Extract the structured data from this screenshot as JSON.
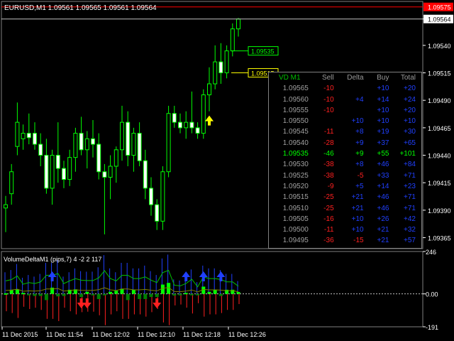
{
  "window": {
    "symbol_title": "EURUSD,M1  1.09561 1.09565 1.09561 1.09564",
    "indicator_title": "VolumeDeltaM1 (pips,7) 4 -2 2 117"
  },
  "price_axis": {
    "labels": [
      "1.09564",
      "1.09540",
      "1.09515",
      "1.09490",
      "1.09465",
      "1.09440",
      "1.09415",
      "1.09390",
      "1.09365"
    ],
    "ask_label": "1.09575",
    "current_label": "1.09564",
    "ask_color": "#ff0000"
  },
  "indicator_axis": {
    "labels": [
      "246",
      "0.00",
      "-191"
    ]
  },
  "time_axis": {
    "labels": [
      "11 Dec 2015",
      "11 Dec 11:54",
      "11 Dec 12:02",
      "11 Dec 12:10",
      "11 Dec 12:18",
      "11 Dec 12:26"
    ]
  },
  "price_levels": {
    "green_label": "1.09535",
    "yellow_label": "1.09515"
  },
  "vd_table": {
    "headers": {
      "title": "VD M1",
      "sell": "Sell",
      "delta": "Delta",
      "buy": "Buy",
      "total": "Total"
    },
    "rows": [
      {
        "price": "1.09565",
        "sell": "-10",
        "delta": "",
        "buy": "+10",
        "total": "+20"
      },
      {
        "price": "1.09560",
        "sell": "-10",
        "delta": "+4",
        "buy": "+14",
        "total": "+24"
      },
      {
        "price": "1.09555",
        "sell": "-10",
        "delta": "",
        "buy": "+10",
        "total": "+20"
      },
      {
        "price": "1.09550",
        "sell": "",
        "delta": "+10",
        "buy": "+10",
        "total": "+10"
      },
      {
        "price": "1.09545",
        "sell": "-11",
        "delta": "+8",
        "buy": "+19",
        "total": "+30"
      },
      {
        "price": "1.09540",
        "sell": "-28",
        "delta": "+9",
        "buy": "+37",
        "total": "+65"
      },
      {
        "price": "1.09535",
        "sell": "-46",
        "delta": "+9",
        "buy": "+55",
        "total": "+101",
        "highlight": true
      },
      {
        "price": "1.09530",
        "sell": "-38",
        "delta": "+8",
        "buy": "+46",
        "total": "+84"
      },
      {
        "price": "1.09525",
        "sell": "-38",
        "delta": "-5",
        "buy": "+33",
        "total": "+71"
      },
      {
        "price": "1.09520",
        "sell": "-9",
        "delta": "+5",
        "buy": "+14",
        "total": "+23"
      },
      {
        "price": "1.09515",
        "sell": "-25",
        "delta": "+21",
        "buy": "+46",
        "total": "+71"
      },
      {
        "price": "1.09510",
        "sell": "-25",
        "delta": "+21",
        "buy": "+46",
        "total": "+71"
      },
      {
        "price": "1.09505",
        "sell": "-16",
        "delta": "+10",
        "buy": "+26",
        "total": "+42"
      },
      {
        "price": "1.09500",
        "sell": "-11",
        "delta": "+10",
        "buy": "+21",
        "total": "+32"
      },
      {
        "price": "1.09495",
        "sell": "-36",
        "delta": "-15",
        "buy": "+21",
        "total": "+57"
      }
    ]
  },
  "colors": {
    "candle": "#00ff00",
    "grid": "#444444",
    "buy": "#2040ff",
    "sell": "#ff2020",
    "highlight": "#00ff00",
    "table_price": "#a0a0a0"
  },
  "chart_data": {
    "type": "candlestick",
    "price_range": [
      1.09355,
      1.0958
    ],
    "candles": [
      {
        "o": 1.09392,
        "h": 1.09403,
        "l": 1.0937,
        "c": 1.09395
      },
      {
        "o": 1.09405,
        "h": 1.09432,
        "l": 1.09395,
        "c": 1.09425
      },
      {
        "o": 1.09448,
        "h": 1.09488,
        "l": 1.0944,
        "c": 1.0947
      },
      {
        "o": 1.09455,
        "h": 1.09468,
        "l": 1.09445,
        "c": 1.0946
      },
      {
        "o": 1.0946,
        "h": 1.09478,
        "l": 1.0945,
        "c": 1.09456
      },
      {
        "o": 1.0946,
        "h": 1.0947,
        "l": 1.09445,
        "c": 1.0945
      },
      {
        "o": 1.0945,
        "h": 1.0946,
        "l": 1.0943,
        "c": 1.0944
      },
      {
        "o": 1.0944,
        "h": 1.09455,
        "l": 1.09405,
        "c": 1.0941
      },
      {
        "o": 1.0941,
        "h": 1.09445,
        "l": 1.09395,
        "c": 1.0944
      },
      {
        "o": 1.0944,
        "h": 1.0947,
        "l": 1.09415,
        "c": 1.09428
      },
      {
        "o": 1.09428,
        "h": 1.09435,
        "l": 1.0941,
        "c": 1.09418
      },
      {
        "o": 1.09418,
        "h": 1.09445,
        "l": 1.09412,
        "c": 1.09438
      },
      {
        "o": 1.09438,
        "h": 1.09465,
        "l": 1.09425,
        "c": 1.0946
      },
      {
        "o": 1.0946,
        "h": 1.09475,
        "l": 1.0944,
        "c": 1.09445
      },
      {
        "o": 1.09445,
        "h": 1.09462,
        "l": 1.09428,
        "c": 1.09455
      },
      {
        "o": 1.09455,
        "h": 1.09472,
        "l": 1.09438,
        "c": 1.0945
      },
      {
        "o": 1.0945,
        "h": 1.0946,
        "l": 1.09418,
        "c": 1.09425
      },
      {
        "o": 1.09425,
        "h": 1.09432,
        "l": 1.09368,
        "c": 1.0942
      },
      {
        "o": 1.0942,
        "h": 1.0944,
        "l": 1.094,
        "c": 1.0943
      },
      {
        "o": 1.0943,
        "h": 1.09448,
        "l": 1.09415,
        "c": 1.09445
      },
      {
        "o": 1.09445,
        "h": 1.09485,
        "l": 1.09435,
        "c": 1.0947
      },
      {
        "o": 1.0947,
        "h": 1.0948,
        "l": 1.0943,
        "c": 1.0944
      },
      {
        "o": 1.0944,
        "h": 1.09465,
        "l": 1.09425,
        "c": 1.0946
      },
      {
        "o": 1.0946,
        "h": 1.0947,
        "l": 1.0943,
        "c": 1.09435
      },
      {
        "o": 1.09435,
        "h": 1.09445,
        "l": 1.094,
        "c": 1.0941
      },
      {
        "o": 1.0941,
        "h": 1.0942,
        "l": 1.09385,
        "c": 1.09395
      },
      {
        "o": 1.09395,
        "h": 1.094,
        "l": 1.09372,
        "c": 1.0938
      },
      {
        "o": 1.0938,
        "h": 1.0943,
        "l": 1.09372,
        "c": 1.09425
      },
      {
        "o": 1.09425,
        "h": 1.09485,
        "l": 1.0942,
        "c": 1.09478
      },
      {
        "o": 1.09478,
        "h": 1.09485,
        "l": 1.09465,
        "c": 1.0947
      },
      {
        "o": 1.0947,
        "h": 1.09478,
        "l": 1.0946,
        "c": 1.09465
      },
      {
        "o": 1.09465,
        "h": 1.0948,
        "l": 1.09455,
        "c": 1.0947
      },
      {
        "o": 1.0947,
        "h": 1.09498,
        "l": 1.0946,
        "c": 1.09465
      },
      {
        "o": 1.09465,
        "h": 1.0947,
        "l": 1.09455,
        "c": 1.0946
      },
      {
        "o": 1.0946,
        "h": 1.095,
        "l": 1.09455,
        "c": 1.09495
      },
      {
        "o": 1.09495,
        "h": 1.0952,
        "l": 1.0948,
        "c": 1.09505
      },
      {
        "o": 1.09505,
        "h": 1.0954,
        "l": 1.095,
        "c": 1.09525
      },
      {
        "o": 1.09525,
        "h": 1.09542,
        "l": 1.09505,
        "c": 1.09515
      },
      {
        "o": 1.09515,
        "h": 1.0954,
        "l": 1.0951,
        "c": 1.09535
      },
      {
        "o": 1.09535,
        "h": 1.0956,
        "l": 1.0953,
        "c": 1.09555
      },
      {
        "o": 1.09555,
        "h": 1.09565,
        "l": 1.09548,
        "c": 1.09564
      }
    ],
    "volume_delta": {
      "range": [
        -191,
        246
      ],
      "arrows_up_at": [
        8,
        31,
        34,
        37
      ],
      "arrows_down_at": [
        13,
        14,
        26
      ],
      "arrow_up_price_index": 35
    }
  }
}
